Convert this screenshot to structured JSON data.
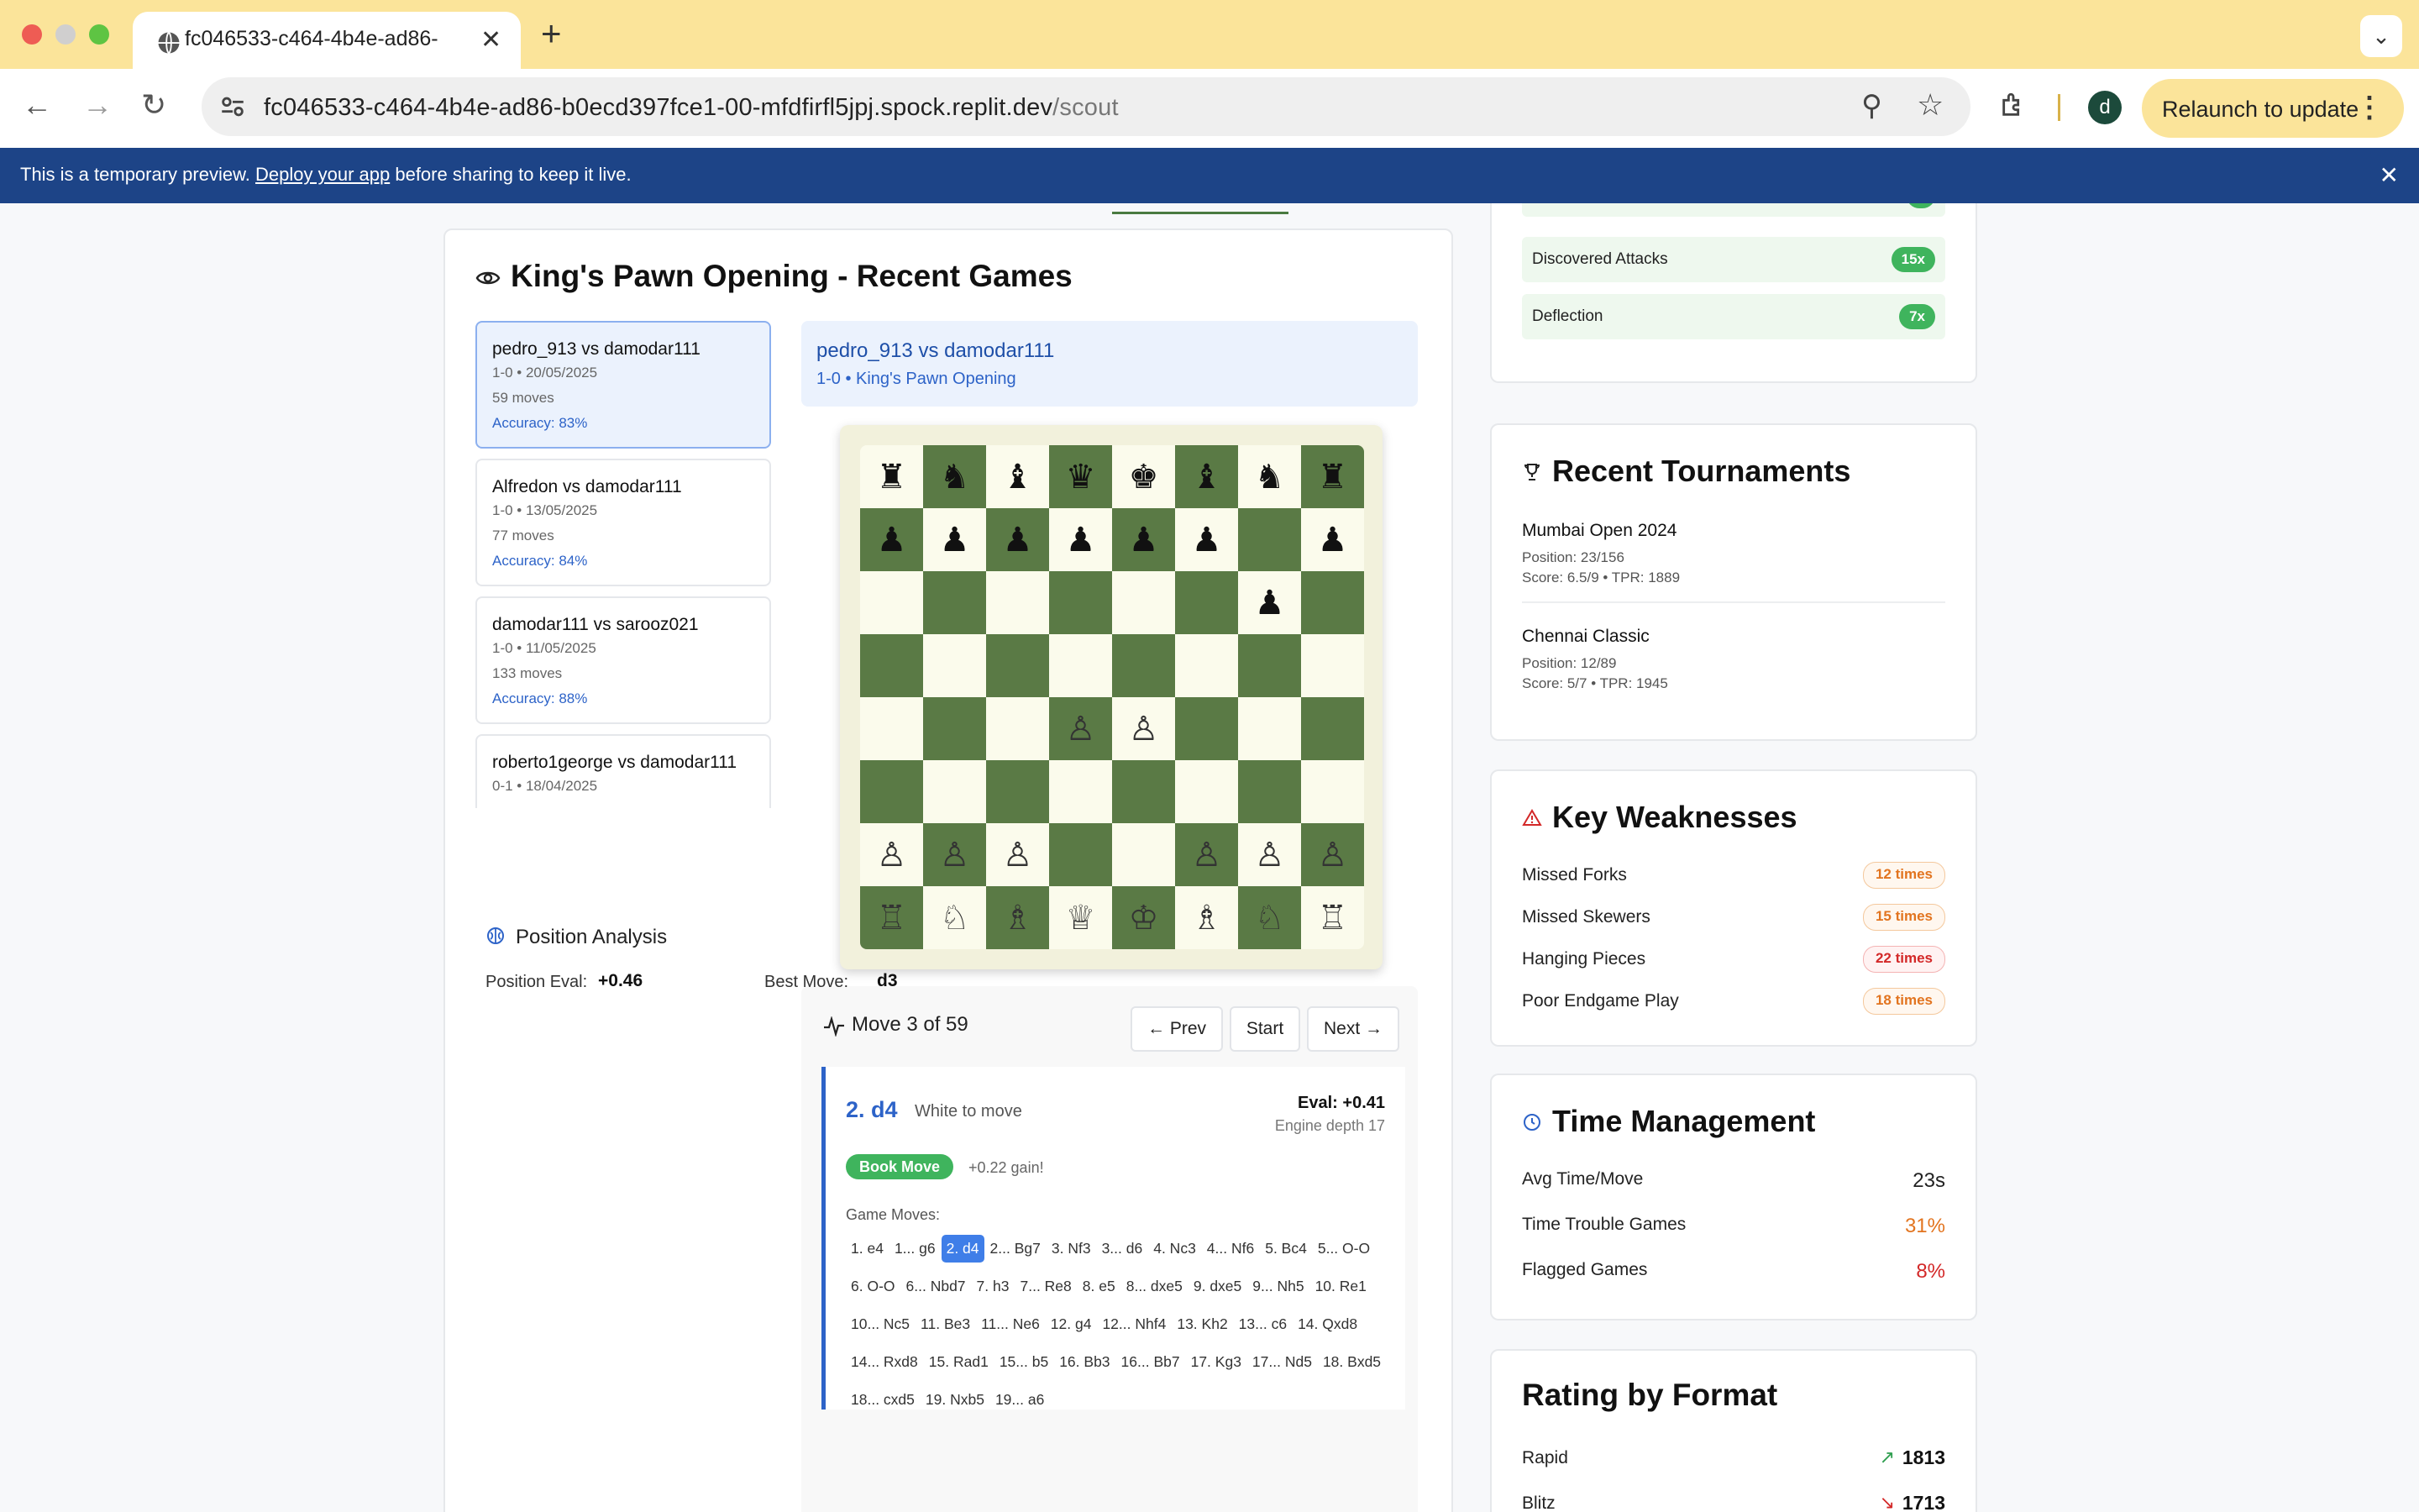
{
  "browser": {
    "tab_title": "fc046533-c464-4b4e-ad86-",
    "url_host": "fc046533-c464-4b4e-ad86-b0ecd397fce1-00-mfdfirfl5jpj.spock.replit.dev",
    "url_path": "/scout",
    "relaunch_label": "Relaunch to update",
    "profile_initial": "d"
  },
  "banner": {
    "prefix": "This is a temporary preview.",
    "link": "Deploy your app",
    "suffix": "before sharing to keep it live."
  },
  "main": {
    "title": "King's Pawn Opening - Recent Games",
    "games": [
      {
        "title": "pedro_913 vs damodar111",
        "meta": "1-0 • 20/05/2025",
        "moves": "59 moves",
        "accuracy": "Accuracy: 83%"
      },
      {
        "title": "Alfredon vs damodar111",
        "meta": "1-0 • 13/05/2025",
        "moves": "77 moves",
        "accuracy": "Accuracy: 84%"
      },
      {
        "title": "damodar111 vs sarooz021",
        "meta": "1-0 • 11/05/2025",
        "moves": "133 moves",
        "accuracy": "Accuracy: 88%"
      },
      {
        "title": "roberto1george vs damodar111",
        "meta": "0-1 • 18/04/2025",
        "moves": "",
        "accuracy": ""
      }
    ],
    "selected_game": {
      "title": "pedro_913 vs damodar111",
      "subtitle": "1-0 • King's Pawn Opening"
    },
    "board": [
      [
        "♜",
        "♞",
        "♝",
        "♛",
        "♚",
        "♝",
        "♞",
        "♜"
      ],
      [
        "♟",
        "♟",
        "♟",
        "♟",
        "♟",
        "♟",
        "",
        "♟"
      ],
      [
        "",
        "",
        "",
        "",
        "",
        "",
        "♟",
        ""
      ],
      [
        "",
        "",
        "",
        "",
        "",
        "",
        "",
        ""
      ],
      [
        "",
        "",
        "",
        "♙",
        "♙",
        "",
        "",
        ""
      ],
      [
        "",
        "",
        "",
        "",
        "",
        "",
        "",
        ""
      ],
      [
        "♙",
        "♙",
        "♙",
        "",
        "",
        "♙",
        "♙",
        "♙"
      ],
      [
        "♖",
        "♘",
        "♗",
        "♕",
        "♔",
        "♗",
        "♘",
        "♖"
      ]
    ],
    "move_nav": {
      "label": "Move 3 of 59",
      "prev": "← Prev",
      "start": "Start",
      "next": "Next →"
    },
    "current_move": {
      "move": "2. d4",
      "side": "White to move",
      "eval": "Eval: +0.41",
      "depth": "Engine depth 17",
      "badge": "Book Move",
      "gain": "+0.22 gain!",
      "game_moves_label": "Game Moves:"
    },
    "moves": [
      "1. e4",
      "1... g6",
      "2. d4",
      "2... Bg7",
      "3. Nf3",
      "3... d6",
      "4. Nc3",
      "4... Nf6",
      "5. Bc4",
      "5... O-O",
      "6. O-O",
      "6... Nbd7",
      "7. h3",
      "7... Re8",
      "8. e5",
      "8... dxe5",
      "9. dxe5",
      "9... Nh5",
      "10. Re1",
      "10... Nc5",
      "11. Be3",
      "11... Ne6",
      "12. g4",
      "12... Nhf4",
      "13. Kh2",
      "13... c6",
      "14. Qxd8",
      "14... Rxd8",
      "15. Rad1",
      "15... b5",
      "16. Bb3",
      "16... Bb7",
      "17. Kg3",
      "17... Nd5",
      "18. Bxd5",
      "18... cxd5",
      "19. Nxb5",
      "19... a6"
    ],
    "current_move_index": 2,
    "position_analysis": {
      "title": "Position Analysis",
      "eval_label": "Position Eval:",
      "eval_value": "+0.46",
      "best_label": "Best Move:",
      "best_value": "d3"
    }
  },
  "patterns": [
    {
      "label": "Discovered Attacks",
      "count": "15x"
    },
    {
      "label": "Deflection",
      "count": "7x"
    }
  ],
  "tournaments": {
    "title": "Recent Tournaments",
    "items": [
      {
        "name": "Mumbai Open 2024",
        "position": "Position: 23/156",
        "score": "Score: 6.5/9 • TPR: 1889"
      },
      {
        "name": "Chennai Classic",
        "position": "Position: 12/89",
        "score": "Score: 5/7 • TPR: 1945"
      }
    ]
  },
  "weaknesses": {
    "title": "Key Weaknesses",
    "items": [
      {
        "label": "Missed Forks",
        "count": "12 times",
        "severity": "orange"
      },
      {
        "label": "Missed Skewers",
        "count": "15 times",
        "severity": "orange"
      },
      {
        "label": "Hanging Pieces",
        "count": "22 times",
        "severity": "red"
      },
      {
        "label": "Poor Endgame Play",
        "count": "18 times",
        "severity": "orange"
      }
    ]
  },
  "time_management": {
    "title": "Time Management",
    "items": [
      {
        "label": "Avg Time/Move",
        "value": "23s",
        "color": "#222222"
      },
      {
        "label": "Time Trouble Games",
        "value": "31%",
        "color": "#e2741f"
      },
      {
        "label": "Flagged Games",
        "value": "8%",
        "color": "#d32828"
      }
    ]
  },
  "rating_by_format": {
    "title": "Rating by Format",
    "items": [
      {
        "label": "Rapid",
        "value": "1813",
        "trend": "up",
        "trend_color": "#2e9e4f"
      },
      {
        "label": "Blitz",
        "value": "1713",
        "trend": "down",
        "trend_color": "#d32828"
      }
    ]
  },
  "colors": {
    "accent": "#2d63c8",
    "board_dark": "#5a7a45",
    "board_light": "#fbfbec",
    "banner": "#1d4487",
    "tabbar": "#fbe49a"
  }
}
